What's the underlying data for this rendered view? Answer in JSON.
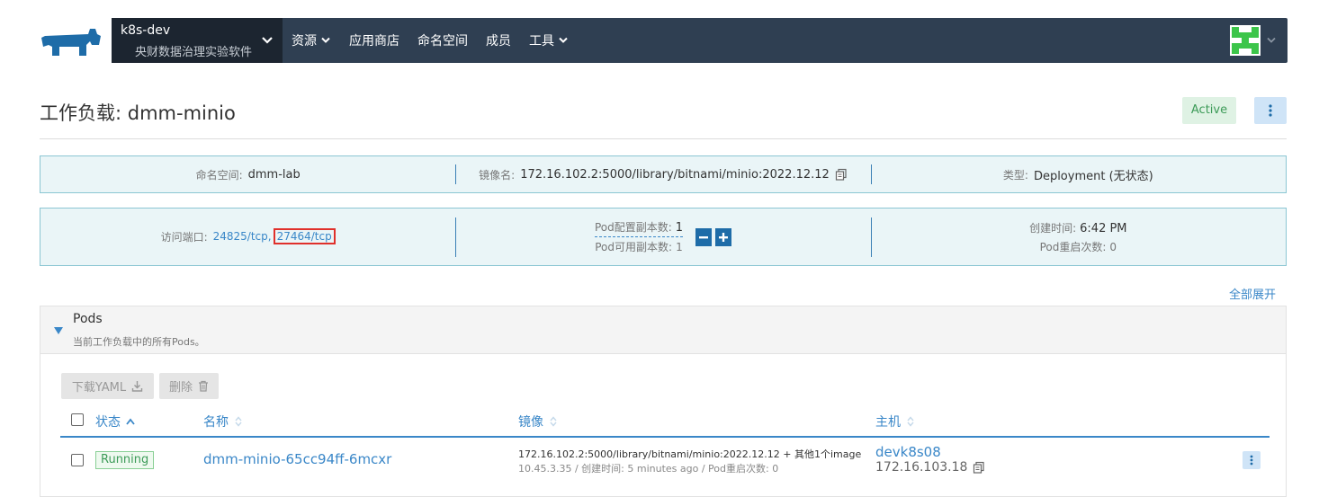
{
  "header": {
    "cluster_name": "k8s-dev",
    "project_name": "央财数据治理实验软件",
    "nav": [
      "资源",
      "应用商店",
      "命名空间",
      "成员",
      "工具"
    ]
  },
  "page": {
    "title": "工作负载: dmm-minio",
    "status": "Active"
  },
  "info": {
    "namespace_label": "命名空间:",
    "namespace": "dmm-lab",
    "image_label": "镜像名:",
    "image": "172.16.102.2:5000/library/bitnami/minio:2022.12.12",
    "type_label": "类型:",
    "type": "Deployment (无状态)",
    "ports_label": "访问端口:",
    "port1": "24825/tcp",
    "port_sep": ",",
    "port2": "27464/tcp",
    "replicas_config_label": "Pod配置副本数:",
    "replicas_config": "1",
    "replicas_avail_label": "Pod可用副本数:",
    "replicas_avail": "1",
    "created_label": "创建时间:",
    "created": "6:42 PM",
    "restarts_label": "Pod重启次数:",
    "restarts": "0"
  },
  "expand_all": "全部展开",
  "pods": {
    "title": "Pods",
    "subtitle": "当前工作负载中的所有Pods。",
    "download_yaml": "下载YAML",
    "delete": "删除",
    "columns": {
      "status": "状态",
      "name": "名称",
      "image": "镜像",
      "host": "主机"
    },
    "rows": [
      {
        "status": "Running",
        "name": "dmm-minio-65cc94ff-6mcxr",
        "image": "172.16.102.2:5000/library/bitnami/minio:2022.12.12",
        "image_more": "+ 其他1个image",
        "image_sub": "10.45.3.35 / 创建时间: 5 minutes ago / Pod重启次数: 0",
        "host": "devk8s08",
        "host_ip": "172.16.103.18"
      }
    ]
  },
  "colors": {
    "topbar": "#2f3f52",
    "accent": "#3a87c8",
    "active_green": "#3d9b58",
    "highlight_red": "#e0302b"
  }
}
